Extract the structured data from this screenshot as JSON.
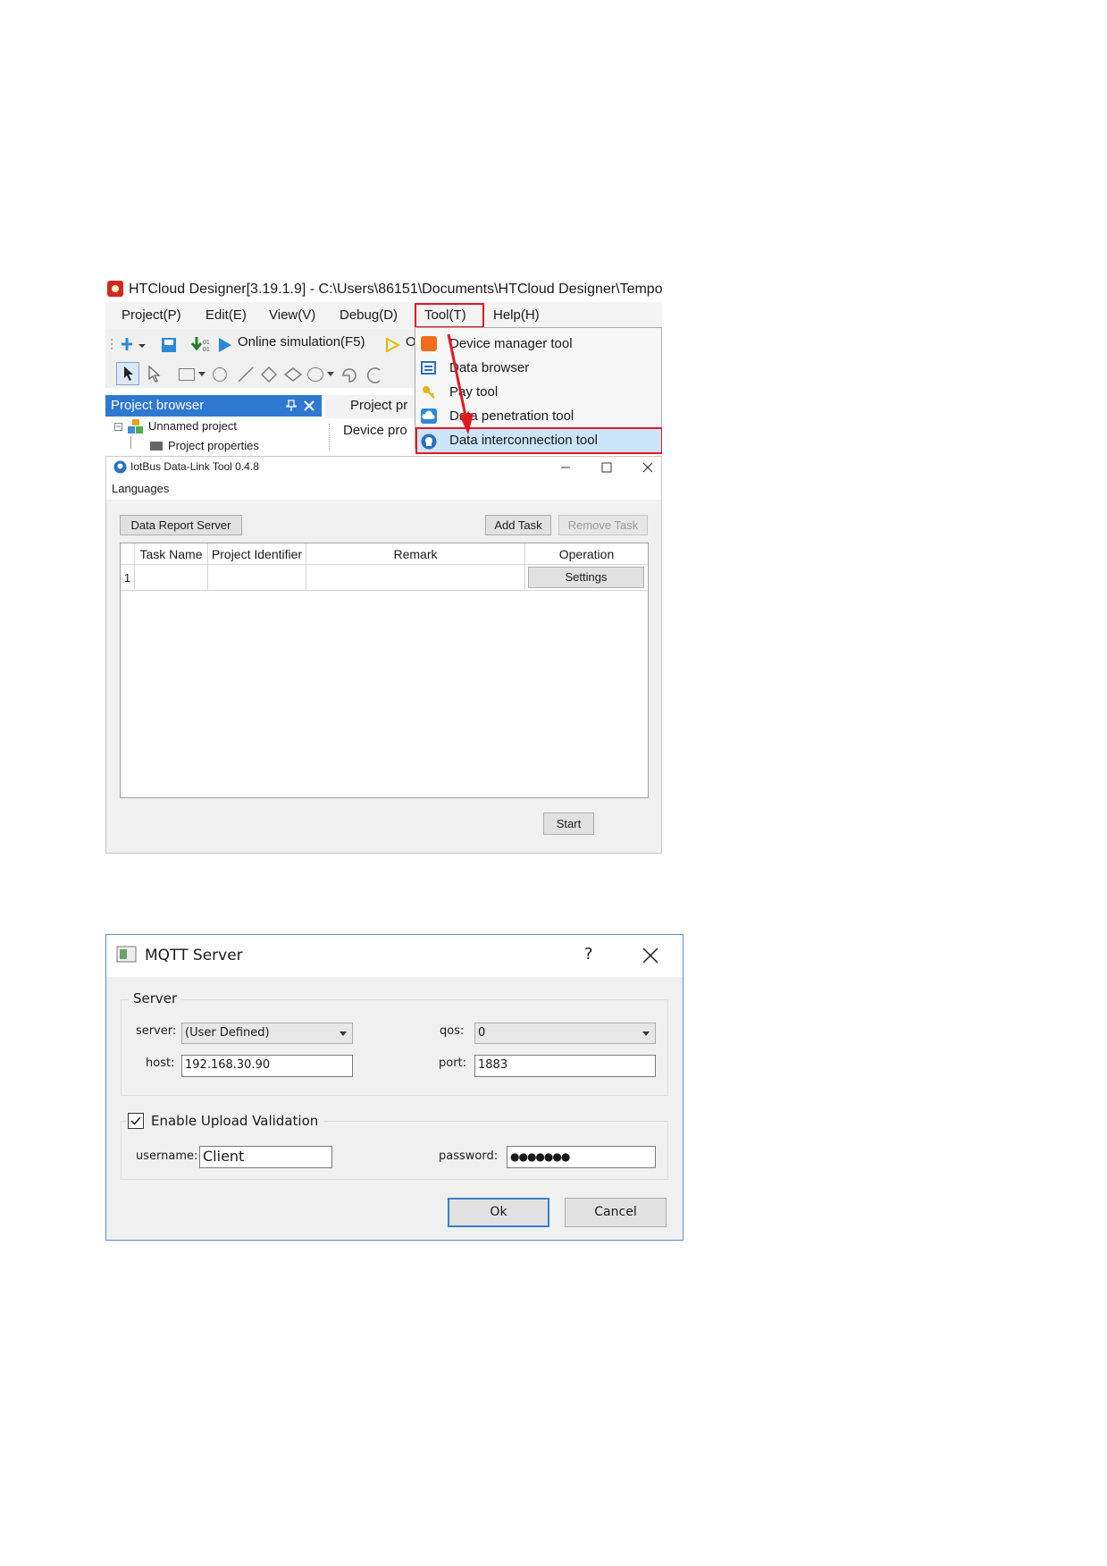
{
  "designer": {
    "title": "HTCloud Designer[3.19.1.9] - C:\\Users\\86151\\Documents\\HTCloud Designer\\Tempo",
    "menu": [
      "Project(P)",
      "Edit(E)",
      "View(V)",
      "Debug(D)",
      "Tool(T)",
      "Help(H)"
    ],
    "toolbar": {
      "online_simulation": "Online simulation(F5)",
      "cut_off": "O"
    },
    "project_browser": {
      "title": "Project browser",
      "tree_root": "Unnamed project",
      "tree_child": "Project properties"
    },
    "tabs": {
      "project": "Project pr",
      "device": "Device pro"
    },
    "tool_menu_items": [
      "Device manager tool",
      "Data browser",
      "Pay tool",
      "Data penetration tool",
      "Data interconnection tool"
    ]
  },
  "datalink": {
    "title": "IotBus Data-Link Tool 0.4.8",
    "menu_languages": "Languages",
    "data_report_server": "Data Report Server",
    "add_task": "Add Task",
    "remove_task": "Remove Task",
    "columns": [
      "Task Name",
      "Project Identifier",
      "Remark",
      "Operation"
    ],
    "rows": [
      {
        "index": "1",
        "operation": "Settings"
      }
    ],
    "start": "Start"
  },
  "mqtt": {
    "title": "MQTT Server",
    "help": "?",
    "server_group": "Server",
    "server_label": "server:",
    "server_value": "(User Defined)",
    "qos_label": "qos:",
    "qos_value": "0",
    "host_label": "host:",
    "host_value": "192.168.30.90",
    "port_label": "port:",
    "port_value": "1883",
    "validation_label": "Enable Upload Validation",
    "validation_checked": true,
    "username_label": "username:",
    "username_value": "Client",
    "password_label": "password:",
    "password_value": "●●●●●●●",
    "ok": "Ok",
    "cancel": "Cancel"
  },
  "colors": {
    "highlight_red": "#e0191f",
    "menu_highlight": "#cce4f7",
    "title_blue": "#2f78d0"
  }
}
